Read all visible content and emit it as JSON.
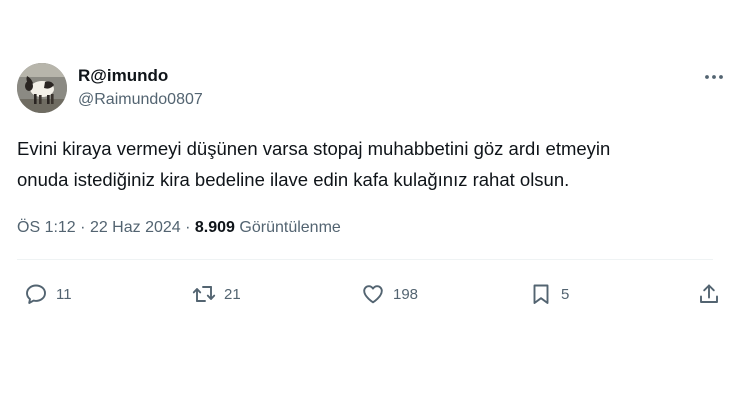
{
  "author": {
    "display_name": "R@imundo",
    "handle": "@Raimundo0807"
  },
  "tweet": {
    "text_lines": [
      "Evini kiraya vermeyi düşünen varsa stopaj muhabbetini göz ardı etmeyin",
      "onuda istediğiniz kira bedeline ilave edin kafa kulağınız rahat olsun."
    ],
    "time": "ÖS 1:12",
    "separator": "·",
    "date": "22 Haz 2024",
    "views_count": "8.909",
    "views_label": "Görüntülenme"
  },
  "actions": {
    "replies": "11",
    "reposts": "21",
    "likes": "198",
    "bookmarks": "5"
  },
  "icons": {
    "more": "more-dots-icon",
    "reply": "reply-bubble-icon",
    "repost": "repost-arrows-icon",
    "like": "heart-icon",
    "bookmark": "bookmark-icon",
    "share": "share-upload-icon"
  },
  "colors": {
    "text_primary": "#0f1419",
    "text_secondary": "#536471",
    "divider": "#eff3f4"
  }
}
